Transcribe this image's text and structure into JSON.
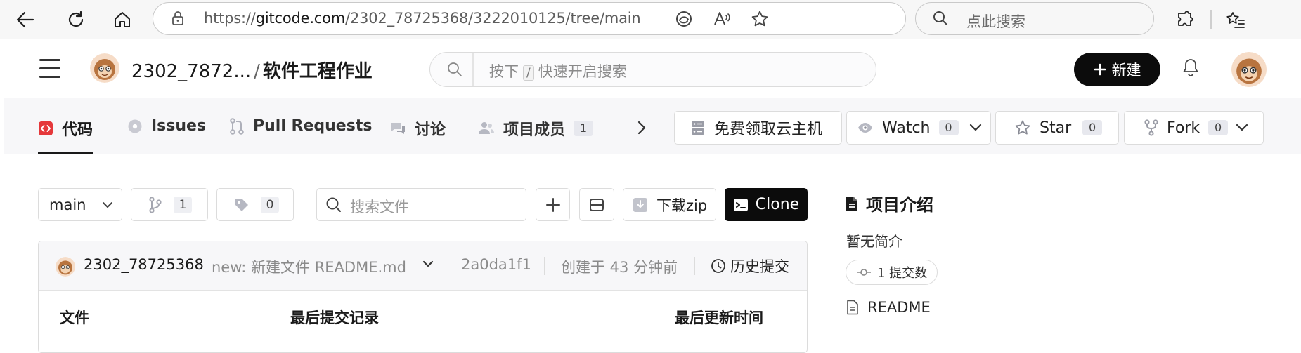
{
  "browser": {
    "url_prefix": "https://",
    "url_host": "gitcode.com",
    "url_path": "/2302_78725368/3222010125/tree/main",
    "search_placeholder": "点此搜索"
  },
  "header": {
    "repo_owner": "2302_7872...",
    "separator": "/",
    "repo_name": "软件工程作业",
    "search_prefix": "按下",
    "search_key": "/",
    "search_suffix": "快速开启搜索",
    "new_button": "新建"
  },
  "tabs": [
    {
      "label": "代码",
      "active": true
    },
    {
      "label": "Issues"
    },
    {
      "label": "Pull Requests"
    },
    {
      "label": "讨论"
    },
    {
      "label": "项目成员",
      "count": "1"
    }
  ],
  "actions": {
    "cloud_host": "免费领取云主机",
    "watch_label": "Watch",
    "watch_count": "0",
    "star_label": "Star",
    "star_count": "0",
    "fork_label": "Fork",
    "fork_count": "0"
  },
  "toolbar": {
    "branch": "main",
    "branch_count": "1",
    "tag_count": "0",
    "file_search_placeholder": "搜索文件",
    "download_label": "下载zip",
    "clone_label": "Clone"
  },
  "commit": {
    "author": "2302_78725368",
    "message": "new: 新建文件 README.md",
    "hash": "2a0da1f1",
    "created": "创建于 43 分钟前",
    "history_label": "历史提交"
  },
  "file_table": {
    "columns": [
      "文件",
      "最后提交记录",
      "最后更新时间"
    ]
  },
  "intro": {
    "title": "项目介绍",
    "description": "暂无简介",
    "commit_count_label": "1 提交数",
    "readme_label": "README"
  },
  "colors": {
    "accent_red": "#e5383b",
    "primary_black": "#0c0c0c",
    "tabbar_bg": "#f7f7f9"
  }
}
